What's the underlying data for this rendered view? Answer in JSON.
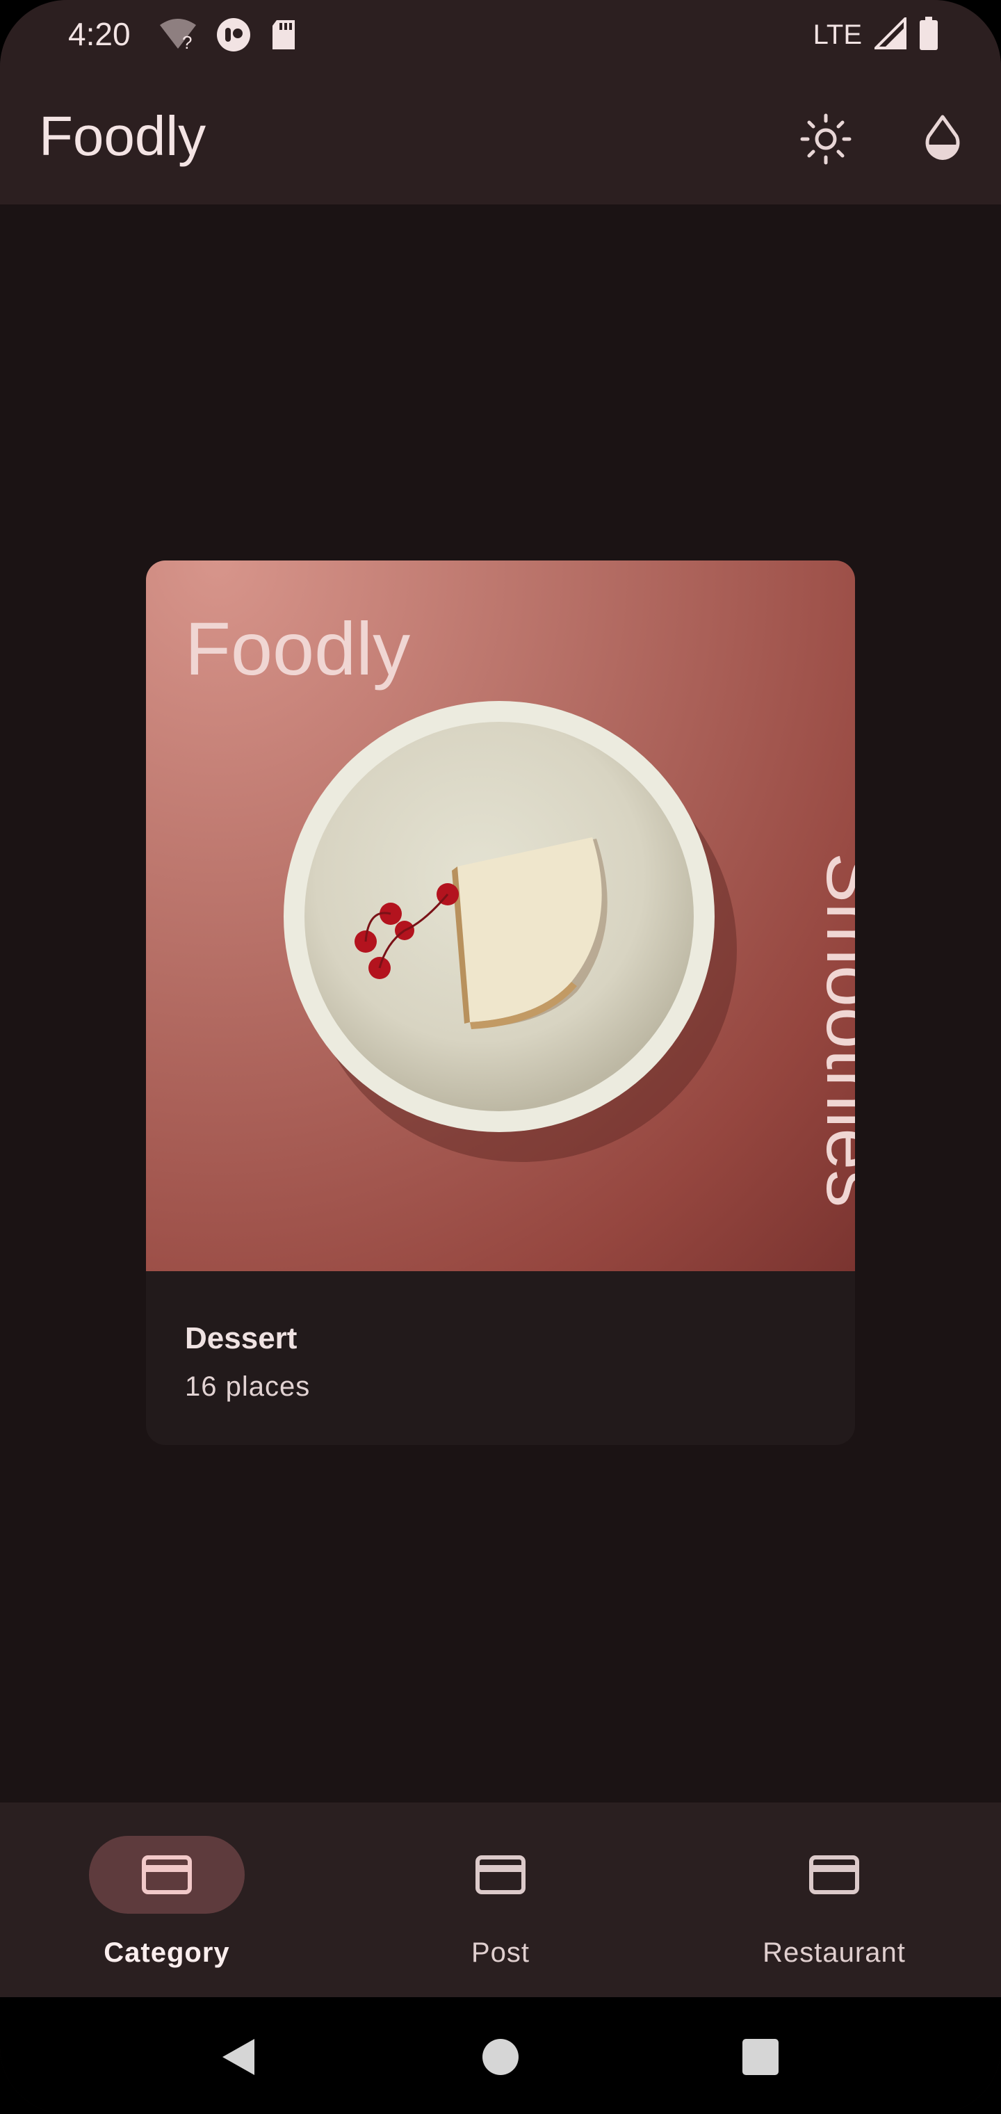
{
  "status_bar": {
    "time": "4:20",
    "network_label": "LTE",
    "icons_left": [
      "wifi-unknown-icon",
      "vpn-key-icon",
      "sd-card-icon"
    ],
    "icons_right": [
      "signal-icon",
      "battery-icon"
    ]
  },
  "app_bar": {
    "title": "Foodly",
    "actions": [
      {
        "name": "brightness-icon"
      },
      {
        "name": "theme-drop-icon"
      }
    ]
  },
  "card": {
    "image_brand": "Foodly",
    "image_word": "Smoothies",
    "title": "Dessert",
    "subtitle": "16 places"
  },
  "bottom_nav": {
    "items": [
      {
        "label": "Category",
        "icon": "card-icon",
        "active": true
      },
      {
        "label": "Post",
        "icon": "card-icon",
        "active": false
      },
      {
        "label": "Restaurant",
        "icon": "card-icon",
        "active": false
      }
    ]
  },
  "colors": {
    "background": "#1b1314",
    "app_bar": "#2c1f20",
    "active_pill": "#5e3b3d",
    "accent_text": "#f4e4e4"
  }
}
